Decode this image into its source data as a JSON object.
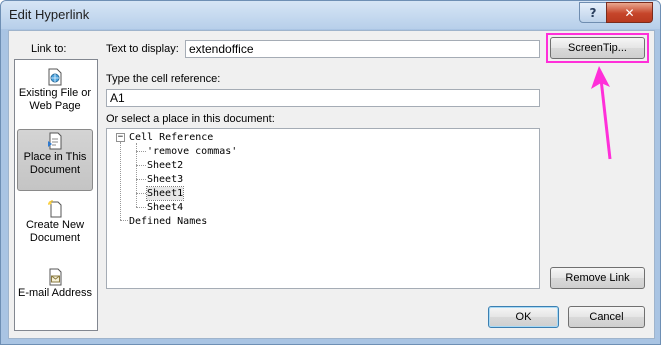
{
  "window": {
    "title": "Edit Hyperlink",
    "help_glyph": "?",
    "close_glyph": "✕"
  },
  "link_to": {
    "label": "Link to:",
    "items": [
      {
        "label_line1": "Existing File or",
        "label_line2": "Web Page",
        "icon": "globe-file-icon"
      },
      {
        "label_line1": "Place in This",
        "label_line2": "Document",
        "icon": "document-place-icon",
        "selected": true
      },
      {
        "label_line1": "Create New",
        "label_line2": "Document",
        "icon": "new-document-icon"
      },
      {
        "label_line1": "E-mail Address",
        "label_line2": "",
        "icon": "email-icon"
      }
    ]
  },
  "text_to_display": {
    "label": "Text to display:",
    "value": "extendoffice"
  },
  "cell_reference": {
    "label": "Type the cell reference:",
    "value": "A1"
  },
  "place_tree": {
    "label": "Or select a place in this document:",
    "nodes": [
      {
        "label": "Cell Reference",
        "level": 0,
        "expanded": true
      },
      {
        "label": "'remove commas'",
        "level": 1
      },
      {
        "label": "Sheet2",
        "level": 1
      },
      {
        "label": "Sheet3",
        "level": 1
      },
      {
        "label": "Sheet1",
        "level": 1,
        "selected": true
      },
      {
        "label": "Sheet4",
        "level": 1
      },
      {
        "label": "Defined Names",
        "level": 0
      }
    ],
    "expander_glyph": "−"
  },
  "buttons": {
    "screentip": "ScreenTip...",
    "remove_link": "Remove Link",
    "ok": "OK",
    "cancel": "Cancel"
  },
  "colors": {
    "highlight": "#ff2fd9",
    "title_bar": "#b7cfea",
    "close_button": "#c6452a"
  }
}
